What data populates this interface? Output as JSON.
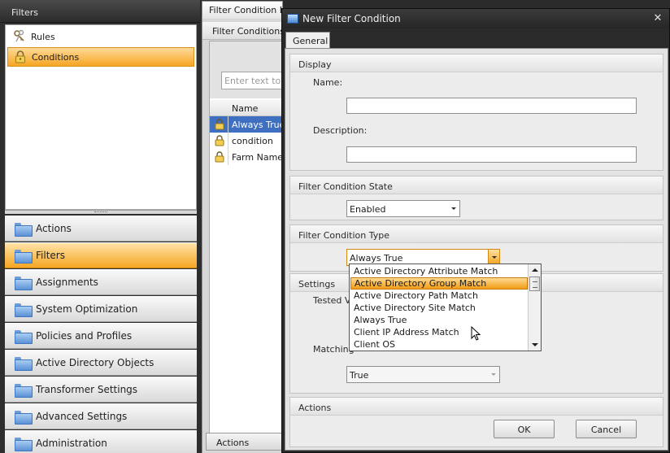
{
  "left_panel": {
    "header": "Filters",
    "items": [
      {
        "label": "Rules",
        "icon": "keys-icon"
      },
      {
        "label": "Conditions",
        "icon": "lock-icon",
        "selected": true
      }
    ],
    "sections": [
      {
        "label": "Actions"
      },
      {
        "label": "Filters",
        "selected": true
      },
      {
        "label": "Assignments"
      },
      {
        "label": "System Optimization"
      },
      {
        "label": "Policies and Profiles"
      },
      {
        "label": "Active Directory Objects"
      },
      {
        "label": "Transformer Settings"
      },
      {
        "label": "Advanced Settings"
      },
      {
        "label": "Administration"
      }
    ]
  },
  "middle_panel": {
    "tab_label": "Filter Condition List",
    "sub_header": "Filter Conditions",
    "search_placeholder": "Enter text to search",
    "column_name": "Name",
    "rows": [
      {
        "name": "Always True",
        "selected": true
      },
      {
        "name": "condition"
      },
      {
        "name": "Farm Name"
      }
    ],
    "actions_label": "Actions"
  },
  "dialog": {
    "title": "New Filter Condition",
    "close_glyph": "✕",
    "tab_label": "General",
    "display": {
      "header": "Display",
      "name_label": "Name:",
      "name_value": "",
      "description_label": "Description:",
      "description_value": ""
    },
    "state": {
      "header": "Filter Condition State",
      "value": "Enabled"
    },
    "type": {
      "header": "Filter Condition Type",
      "value": "Always True",
      "options": [
        "Active Directory Attribute Match",
        "Active Directory Group Match",
        "Active Directory Path Match",
        "Active Directory Site Match",
        "Always True",
        "Client IP Address Match",
        "Client OS"
      ],
      "highlighted_index": 1
    },
    "settings": {
      "header": "Settings",
      "tested_label": "Tested V",
      "matching_label": "Matching",
      "matching_value": "True"
    },
    "actions": {
      "header": "Actions",
      "ok_label": "OK",
      "cancel_label": "Cancel"
    }
  },
  "colors": {
    "selection_orange": "#f6a623",
    "selection_blue": "#3e6fc0",
    "dark_chrome": "#2b2b2b"
  }
}
